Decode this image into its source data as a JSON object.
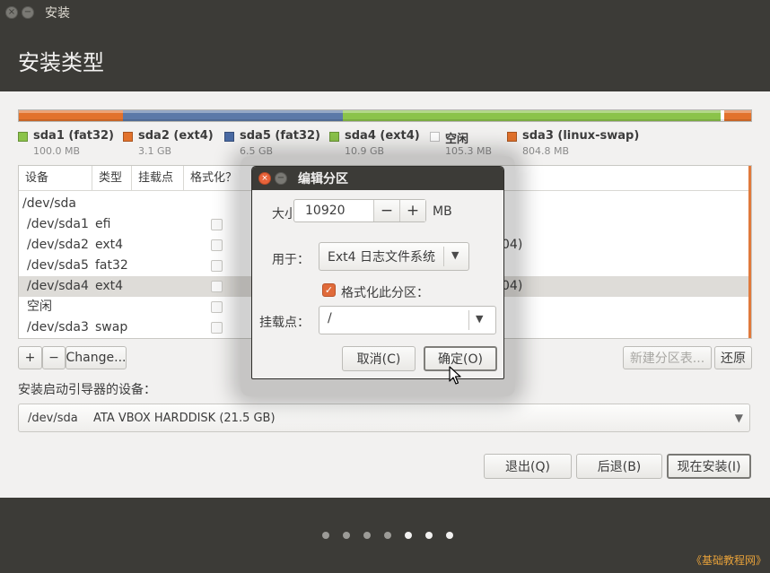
{
  "window": {
    "title": "安装"
  },
  "header": {
    "title": "安装类型"
  },
  "partition_bar": [
    {
      "pct": 14.2,
      "color": "#e2722c"
    },
    {
      "pct": 30.0,
      "color": "#5b79a8"
    },
    {
      "pct": 51.6,
      "color": "#8bc34a"
    },
    {
      "pct": 0.5,
      "color": "#ffffff"
    },
    {
      "pct": 3.7,
      "color": "#e2722c"
    }
  ],
  "legend": [
    {
      "name": "sda1 (fat32)",
      "size": "100.0 MB",
      "color": "#8bc34a"
    },
    {
      "name": "sda2 (ext4)",
      "size": "3.1 GB",
      "color": "#e2722c"
    },
    {
      "name": "sda5 (fat32)",
      "size": "6.5 GB",
      "color": "#4a6aa3"
    },
    {
      "name": "sda4 (ext4)",
      "size": "10.9 GB",
      "color": "#8bc34a"
    },
    {
      "name": "空闲",
      "size": "105.3 MB",
      "color": "#ffffff"
    },
    {
      "name": "sda3 (linux-swap)",
      "size": "804.8 MB",
      "color": "#e2722c"
    }
  ],
  "table": {
    "columns": [
      "设备",
      "类型",
      "挂载点",
      "格式化？"
    ],
    "rows": [
      {
        "device": "/dev/sda",
        "type": "",
        "tail": "",
        "indent": false,
        "checkbox": false,
        "selected": false
      },
      {
        "device": "/dev/sda1",
        "type": "efi",
        "tail": "",
        "indent": true,
        "checkbox": true,
        "selected": false
      },
      {
        "device": "/dev/sda2",
        "type": "ext4",
        "tail": "04)",
        "indent": true,
        "checkbox": true,
        "selected": false
      },
      {
        "device": "/dev/sda5",
        "type": "fat32",
        "tail": "",
        "indent": true,
        "checkbox": true,
        "selected": false
      },
      {
        "device": "/dev/sda4",
        "type": "ext4",
        "tail": "04)",
        "indent": true,
        "checkbox": true,
        "selected": true
      },
      {
        "device": "空闲",
        "type": "",
        "tail": "",
        "indent": true,
        "checkbox": true,
        "selected": false
      },
      {
        "device": "/dev/sda3",
        "type": "swap",
        "tail": "",
        "indent": true,
        "checkbox": true,
        "selected": false
      }
    ]
  },
  "toolbar": {
    "add": "+",
    "remove": "−",
    "change": "Change...",
    "new_table": "新建分区表...",
    "revert": "还原"
  },
  "boot": {
    "label": "安装启动引导器的设备：",
    "device": "/dev/sda",
    "description": "ATA VBOX HARDDISK (21.5 GB)"
  },
  "nav": {
    "quit": "退出(Q)",
    "back": "后退(B)",
    "install": "现在安装(I)"
  },
  "steps": {
    "total": 7,
    "done": 4
  },
  "watermark": "《基础教程网》",
  "dialog": {
    "title": "编辑分区",
    "size_label": "大小：",
    "size_value": "10920",
    "size_unit": "MB",
    "minus": "−",
    "plus": "+",
    "use_label": "用于：",
    "use_value": "Ext4 日志文件系统",
    "format_label": "格式化此分区：",
    "format_checked": true,
    "mount_label": "挂载点：",
    "mount_value": "/",
    "cancel": "取消(C)",
    "ok": "确定(O)"
  }
}
